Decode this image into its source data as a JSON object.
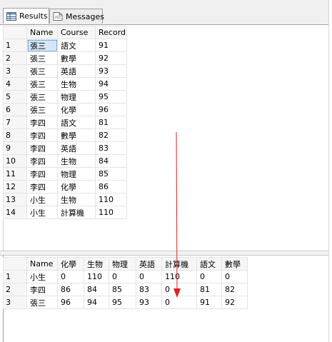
{
  "tabs": [
    {
      "label": "Results",
      "icon": "grid-icon",
      "active": true
    },
    {
      "label": "Messages",
      "icon": "messages-icon",
      "active": false
    }
  ],
  "result1": {
    "columns": [
      "Name",
      "Course",
      "Record"
    ],
    "rows": [
      [
        "1",
        "張三",
        "語文",
        "91"
      ],
      [
        "2",
        "張三",
        "數學",
        "92"
      ],
      [
        "3",
        "張三",
        "英語",
        "93"
      ],
      [
        "4",
        "張三",
        "生物",
        "94"
      ],
      [
        "5",
        "張三",
        "物理",
        "95"
      ],
      [
        "6",
        "張三",
        "化學",
        "96"
      ],
      [
        "7",
        "李四",
        "語文",
        "81"
      ],
      [
        "8",
        "李四",
        "數學",
        "82"
      ],
      [
        "9",
        "李四",
        "英語",
        "83"
      ],
      [
        "10",
        "李四",
        "生物",
        "84"
      ],
      [
        "11",
        "李四",
        "物理",
        "85"
      ],
      [
        "12",
        "李四",
        "化學",
        "86"
      ],
      [
        "13",
        "小生",
        "生物",
        "110"
      ],
      [
        "14",
        "小生",
        "計算機",
        "110"
      ]
    ]
  },
  "result2": {
    "columns": [
      "Name",
      "化學",
      "生物",
      "物理",
      "英語",
      "計算機",
      "語文",
      "數學"
    ],
    "rows": [
      [
        "1",
        "小生",
        "0",
        "110",
        "0",
        "0",
        "110",
        "0",
        "0"
      ],
      [
        "2",
        "李四",
        "86",
        "84",
        "85",
        "83",
        "0",
        "81",
        "82"
      ],
      [
        "3",
        "張三",
        "96",
        "94",
        "95",
        "93",
        "0",
        "91",
        "92"
      ]
    ]
  },
  "annotation": {
    "color": "#e02020"
  }
}
